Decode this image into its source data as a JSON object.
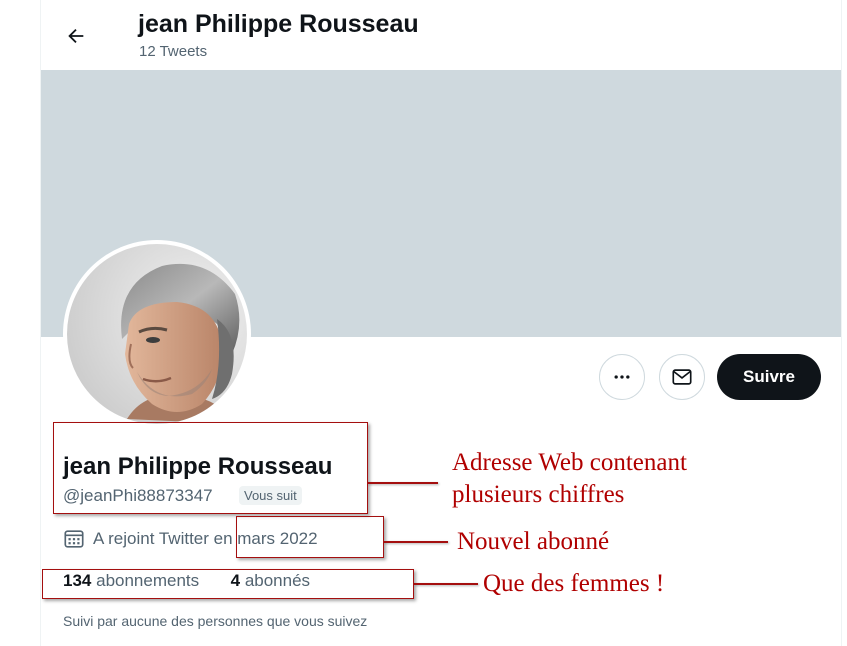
{
  "header": {
    "title": "jean Philippe Rousseau",
    "tweet_count": "12 Tweets",
    "back_icon": "arrow-left-icon"
  },
  "profile": {
    "display_name": "jean Philippe Rousseau",
    "handle": "@jeanPhi88873347",
    "follows_you_badge": "Vous suit",
    "joined": "A rejoint Twitter en mars 2022",
    "following_count": "134",
    "following_label": "abonnements",
    "followers_count": "4",
    "followers_label": "abonnés",
    "followed_by": "Suivi par aucune des personnes que vous suivez",
    "banner_color": "#cfd9de"
  },
  "actions": {
    "more_icon": "more-dots-icon",
    "message_icon": "envelope-icon",
    "follow_label": "Suivre"
  },
  "annotations": {
    "name_note_line1": "Adresse Web contenant",
    "name_note_line2": "plusieurs chiffres",
    "joined_note": "Nouvel abonné",
    "stats_note": "Que des femmes !",
    "color": "#b00000"
  }
}
